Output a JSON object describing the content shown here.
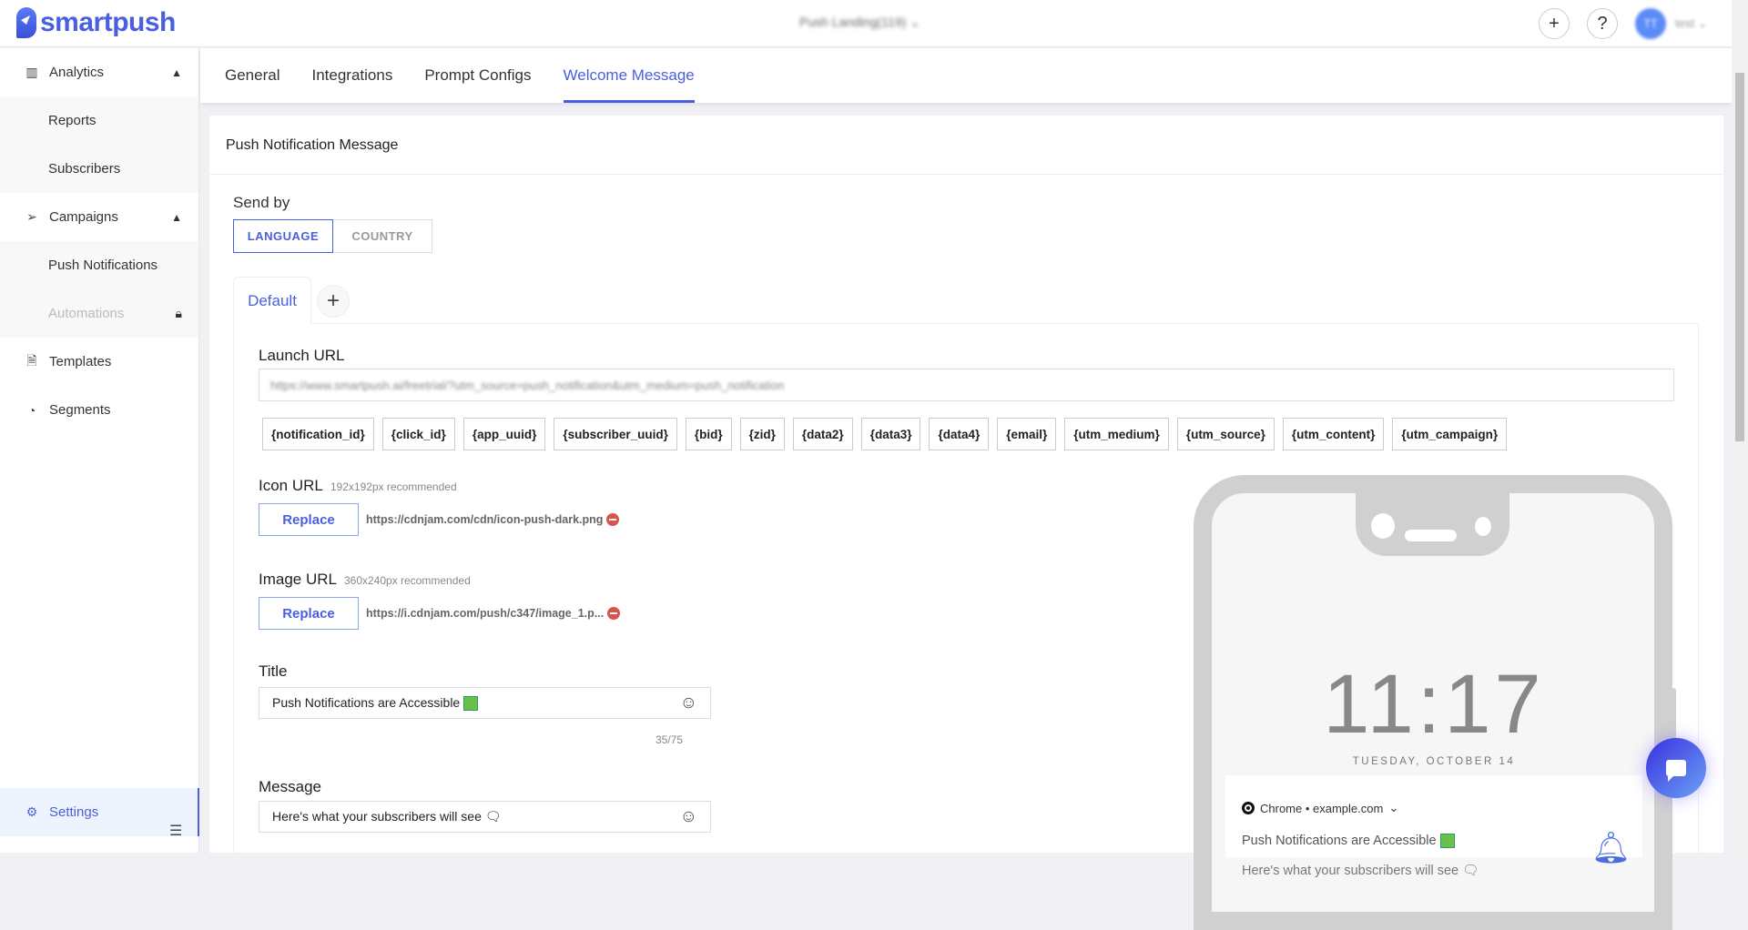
{
  "header": {
    "brand": "smartpush",
    "project": "Push Landing(119)",
    "add": "+",
    "help": "?",
    "avatar": "TT",
    "user": "test"
  },
  "sidebar": {
    "items": [
      {
        "label": "Analytics",
        "icon": "bar-chart-icon"
      },
      {
        "label": "Reports"
      },
      {
        "label": "Subscribers"
      },
      {
        "label": "Campaigns",
        "icon": "send-icon"
      },
      {
        "label": "Push Notifications"
      },
      {
        "label": "Automations",
        "locked": true
      },
      {
        "label": "Templates",
        "icon": "file-icon"
      },
      {
        "label": "Segments",
        "icon": "pie-icon"
      },
      {
        "label": "Settings",
        "icon": "gear-icon"
      }
    ]
  },
  "tabs": [
    "General",
    "Integrations",
    "Prompt Configs",
    "Welcome Message"
  ],
  "card": {
    "title": "Push Notification Message",
    "send_by": "Send by",
    "language": "LANGUAGE",
    "country": "COUNTRY",
    "default_tab": "Default",
    "add_tab": "+",
    "launch_label": "Launch URL",
    "launch_value": "https://www.smartpush.ai/freetrial/?utm_source=push_notification&utm_medium=push_notification",
    "chips": [
      "{notification_id}",
      "{click_id}",
      "{app_uuid}",
      "{subscriber_uuid}",
      "{bid}",
      "{zid}",
      "{data2}",
      "{data3}",
      "{data4}",
      "{email}",
      "{utm_medium}",
      "{utm_source}",
      "{utm_content}",
      "{utm_campaign}"
    ],
    "icon_label": "Icon URL",
    "icon_hint": "192x192px recommended",
    "icon_url": "https://cdnjam.com/cdn/icon-push-dark.png",
    "image_label": "Image URL",
    "image_hint": "360x240px recommended",
    "image_url": "https://i.cdnjam.com/push/c347/image_1.p...",
    "replace": "Replace",
    "title_label": "Title",
    "title_value": "Push Notifications are Accessible",
    "counter": "35/75",
    "message_label": "Message",
    "message_value": "Here's what your subscribers will see"
  },
  "preview": {
    "time": "11:17",
    "date": "TUESDAY, OCTOBER 14",
    "source": "Chrome • example.com",
    "title": "Push Notifications are Accessible",
    "message": "Here's what your subscribers will see"
  },
  "colors": {
    "accent": "#4a5fe0",
    "remove": "#d9534f"
  }
}
